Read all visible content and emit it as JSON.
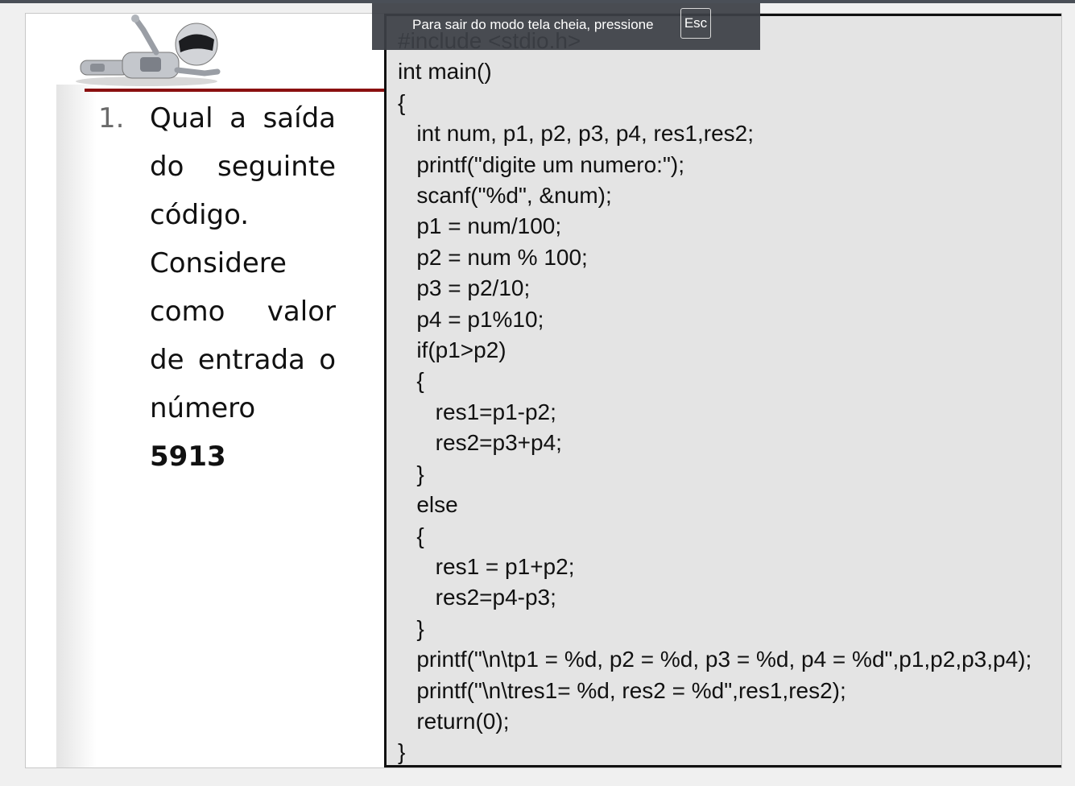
{
  "fullscreen_notice": {
    "message": "Para sair do modo tela cheia, pressione",
    "key": "Esc"
  },
  "slide": {
    "question": {
      "number": "1.",
      "text": "Qual a saída do seguinte código. Considere como valor de entrada o número",
      "value": "5913"
    },
    "code_lines": [
      "#include <stdio.h>",
      "int main()",
      "{",
      "   int num, p1, p2, p3, p4, res1,res2;",
      "   printf(\"digite um numero:\");",
      "   scanf(\"%d\", &num);",
      "   p1 = num/100;",
      "   p2 = num % 100;",
      "   p3 = p2/10;",
      "   p4 = p1%10;",
      "   if(p1>p2)",
      "   {",
      "      res1=p1-p2;",
      "      res2=p3+p4;",
      "   }",
      "   else",
      "   {",
      "      res1 = p1+p2;",
      "      res2=p4-p3;",
      "   }",
      "   printf(\"\\n\\tp1 = %d, p2 = %d, p3 = %d, p4 = %d\",p1,p2,p3,p4);",
      "   printf(\"\\n\\tres1= %d, res2 = %d\",res1,res2);",
      "   return(0);",
      "}"
    ]
  },
  "colors": {
    "accent_line": "#8b1010",
    "code_background": "#e4e4e4",
    "notice_background": "#3c4046"
  },
  "icons": {
    "robot": "robot-illustration"
  }
}
